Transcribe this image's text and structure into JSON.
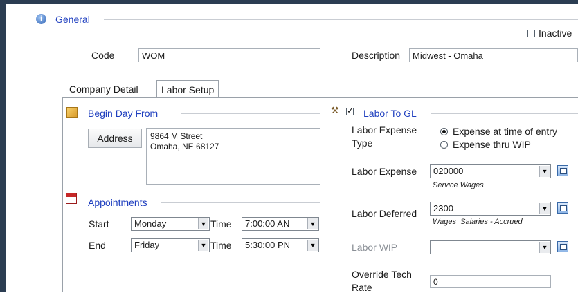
{
  "section": {
    "title": "General"
  },
  "inactive": {
    "label": "Inactive"
  },
  "code": {
    "label": "Code",
    "value": "WOM"
  },
  "description": {
    "label": "Description",
    "value": "Midwest - Omaha"
  },
  "tabs": [
    {
      "label": "Company Detail"
    },
    {
      "label": "Labor Setup"
    }
  ],
  "begin_day": {
    "title": "Begin Day From",
    "address_button": "Address",
    "address_line1": "9864 M Street",
    "address_line2": "Omaha, NE 68127"
  },
  "appointments": {
    "title": "Appointments",
    "start_label": "Start",
    "start_day": "Monday",
    "start_time_label": "Time",
    "start_time": "7:00:00 AN",
    "end_label": "End",
    "end_day": "Friday",
    "end_time_label": "Time",
    "end_time": "5:30:00 PN"
  },
  "labor_gl": {
    "title": "Labor To GL",
    "expense_type_line1": "Labor Expense",
    "expense_type_line2": "Type",
    "option_time_of_entry": "Expense at time of entry",
    "option_thru_wip": "Expense thru WIP",
    "labor_expense_label": "Labor Expense",
    "labor_expense_value": "020000",
    "labor_expense_desc": "Service Wages",
    "labor_deferred_label": "Labor Deferred",
    "labor_deferred_value": "2300",
    "labor_deferred_desc": "Wages_Salaries - Accrued",
    "labor_wip_label": "Labor WIP",
    "labor_wip_value": "",
    "override_line1": "Override Tech",
    "override_line2": "Rate",
    "override_value": "0"
  },
  "colors": {
    "link": "#1f3fbf",
    "frame": "#2b3d52"
  }
}
